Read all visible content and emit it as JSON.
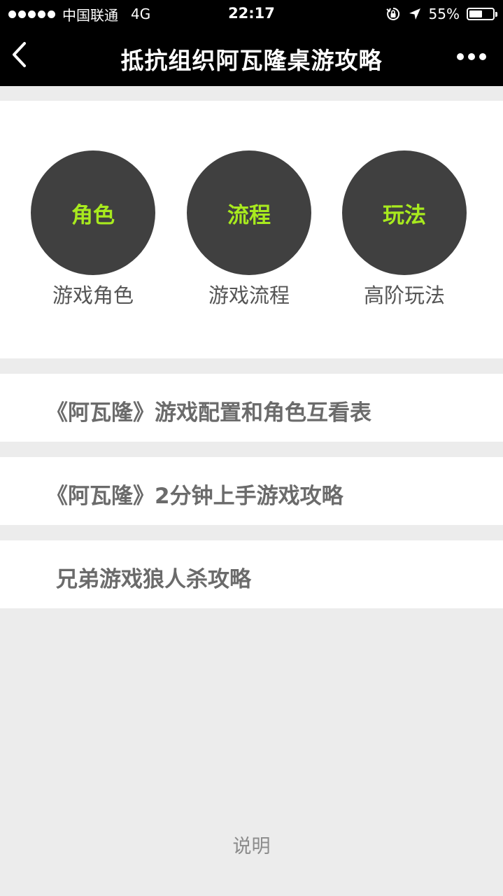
{
  "status_bar": {
    "carrier": "中国联通",
    "network": "4G",
    "time": "22:17",
    "battery_percent": "55%",
    "battery_level": 0.55
  },
  "nav": {
    "title": "抵抗组织阿瓦隆桌游攻略",
    "back_icon": "chevron-left-icon",
    "more_icon": "more-dots-icon"
  },
  "categories": [
    {
      "circle_text": "角色",
      "label": "游戏角色"
    },
    {
      "circle_text": "流程",
      "label": "游戏流程"
    },
    {
      "circle_text": "玩法",
      "label": "高阶玩法"
    }
  ],
  "links": [
    {
      "label": "《阿瓦隆》游戏配置和角色互看表"
    },
    {
      "label": "《阿瓦隆》2分钟上手游戏攻略"
    },
    {
      "label": "兄弟游戏狼人杀攻略"
    }
  ],
  "footer": {
    "label": "说明"
  },
  "colors": {
    "accent": "#a8ea1e",
    "circle": "#404040",
    "nav_background": "#000000",
    "page_background": "#ececec"
  }
}
